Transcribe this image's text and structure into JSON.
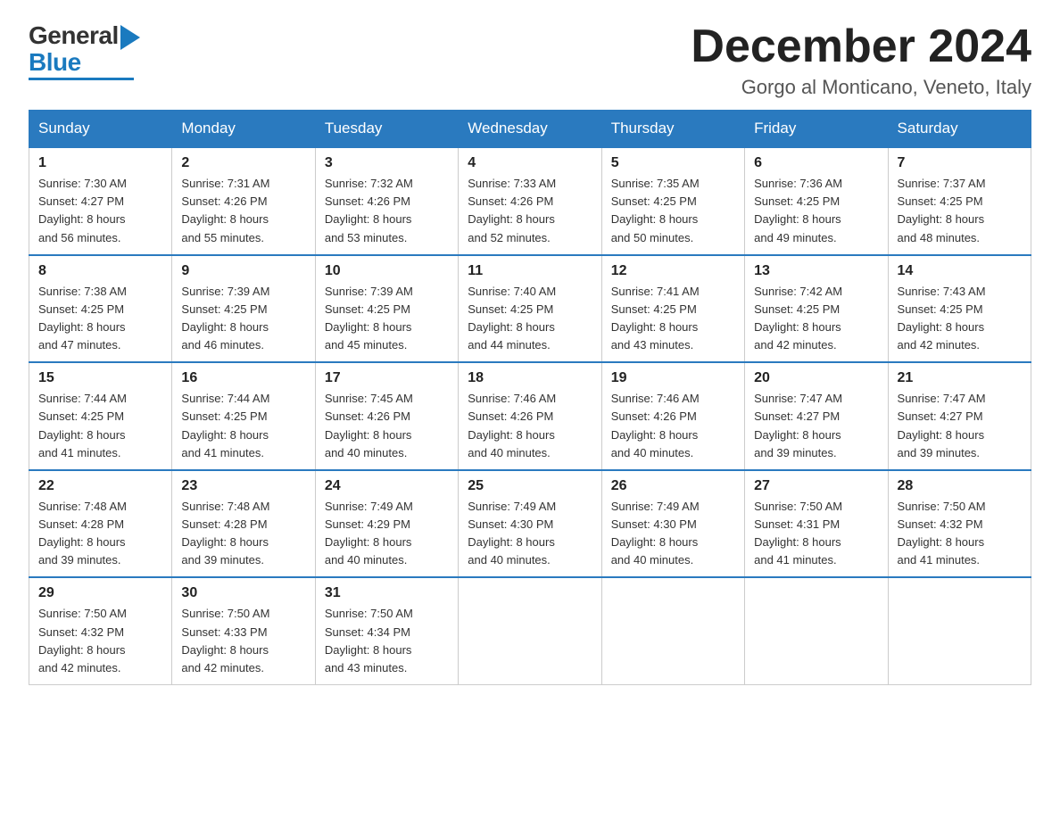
{
  "header": {
    "logo_general": "General",
    "logo_blue": "Blue",
    "month_title": "December 2024",
    "location": "Gorgo al Monticano, Veneto, Italy"
  },
  "weekdays": [
    "Sunday",
    "Monday",
    "Tuesday",
    "Wednesday",
    "Thursday",
    "Friday",
    "Saturday"
  ],
  "weeks": [
    [
      {
        "day": "1",
        "sunrise": "7:30 AM",
        "sunset": "4:27 PM",
        "daylight": "8 hours and 56 minutes."
      },
      {
        "day": "2",
        "sunrise": "7:31 AM",
        "sunset": "4:26 PM",
        "daylight": "8 hours and 55 minutes."
      },
      {
        "day": "3",
        "sunrise": "7:32 AM",
        "sunset": "4:26 PM",
        "daylight": "8 hours and 53 minutes."
      },
      {
        "day": "4",
        "sunrise": "7:33 AM",
        "sunset": "4:26 PM",
        "daylight": "8 hours and 52 minutes."
      },
      {
        "day": "5",
        "sunrise": "7:35 AM",
        "sunset": "4:25 PM",
        "daylight": "8 hours and 50 minutes."
      },
      {
        "day": "6",
        "sunrise": "7:36 AM",
        "sunset": "4:25 PM",
        "daylight": "8 hours and 49 minutes."
      },
      {
        "day": "7",
        "sunrise": "7:37 AM",
        "sunset": "4:25 PM",
        "daylight": "8 hours and 48 minutes."
      }
    ],
    [
      {
        "day": "8",
        "sunrise": "7:38 AM",
        "sunset": "4:25 PM",
        "daylight": "8 hours and 47 minutes."
      },
      {
        "day": "9",
        "sunrise": "7:39 AM",
        "sunset": "4:25 PM",
        "daylight": "8 hours and 46 minutes."
      },
      {
        "day": "10",
        "sunrise": "7:39 AM",
        "sunset": "4:25 PM",
        "daylight": "8 hours and 45 minutes."
      },
      {
        "day": "11",
        "sunrise": "7:40 AM",
        "sunset": "4:25 PM",
        "daylight": "8 hours and 44 minutes."
      },
      {
        "day": "12",
        "sunrise": "7:41 AM",
        "sunset": "4:25 PM",
        "daylight": "8 hours and 43 minutes."
      },
      {
        "day": "13",
        "sunrise": "7:42 AM",
        "sunset": "4:25 PM",
        "daylight": "8 hours and 42 minutes."
      },
      {
        "day": "14",
        "sunrise": "7:43 AM",
        "sunset": "4:25 PM",
        "daylight": "8 hours and 42 minutes."
      }
    ],
    [
      {
        "day": "15",
        "sunrise": "7:44 AM",
        "sunset": "4:25 PM",
        "daylight": "8 hours and 41 minutes."
      },
      {
        "day": "16",
        "sunrise": "7:44 AM",
        "sunset": "4:25 PM",
        "daylight": "8 hours and 41 minutes."
      },
      {
        "day": "17",
        "sunrise": "7:45 AM",
        "sunset": "4:26 PM",
        "daylight": "8 hours and 40 minutes."
      },
      {
        "day": "18",
        "sunrise": "7:46 AM",
        "sunset": "4:26 PM",
        "daylight": "8 hours and 40 minutes."
      },
      {
        "day": "19",
        "sunrise": "7:46 AM",
        "sunset": "4:26 PM",
        "daylight": "8 hours and 40 minutes."
      },
      {
        "day": "20",
        "sunrise": "7:47 AM",
        "sunset": "4:27 PM",
        "daylight": "8 hours and 39 minutes."
      },
      {
        "day": "21",
        "sunrise": "7:47 AM",
        "sunset": "4:27 PM",
        "daylight": "8 hours and 39 minutes."
      }
    ],
    [
      {
        "day": "22",
        "sunrise": "7:48 AM",
        "sunset": "4:28 PM",
        "daylight": "8 hours and 39 minutes."
      },
      {
        "day": "23",
        "sunrise": "7:48 AM",
        "sunset": "4:28 PM",
        "daylight": "8 hours and 39 minutes."
      },
      {
        "day": "24",
        "sunrise": "7:49 AM",
        "sunset": "4:29 PM",
        "daylight": "8 hours and 40 minutes."
      },
      {
        "day": "25",
        "sunrise": "7:49 AM",
        "sunset": "4:30 PM",
        "daylight": "8 hours and 40 minutes."
      },
      {
        "day": "26",
        "sunrise": "7:49 AM",
        "sunset": "4:30 PM",
        "daylight": "8 hours and 40 minutes."
      },
      {
        "day": "27",
        "sunrise": "7:50 AM",
        "sunset": "4:31 PM",
        "daylight": "8 hours and 41 minutes."
      },
      {
        "day": "28",
        "sunrise": "7:50 AM",
        "sunset": "4:32 PM",
        "daylight": "8 hours and 41 minutes."
      }
    ],
    [
      {
        "day": "29",
        "sunrise": "7:50 AM",
        "sunset": "4:32 PM",
        "daylight": "8 hours and 42 minutes."
      },
      {
        "day": "30",
        "sunrise": "7:50 AM",
        "sunset": "4:33 PM",
        "daylight": "8 hours and 42 minutes."
      },
      {
        "day": "31",
        "sunrise": "7:50 AM",
        "sunset": "4:34 PM",
        "daylight": "8 hours and 43 minutes."
      },
      null,
      null,
      null,
      null
    ]
  ],
  "labels": {
    "sunrise": "Sunrise:",
    "sunset": "Sunset:",
    "daylight": "Daylight:"
  }
}
